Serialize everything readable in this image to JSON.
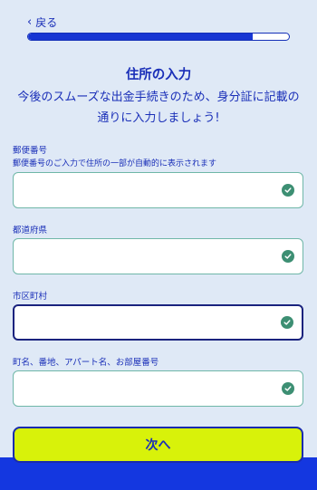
{
  "header": {
    "back_label": "戻る",
    "progress_fraction": 0.86
  },
  "main": {
    "title": "住所の入力",
    "subtitle_line1": "今後のスムーズな出金手続きのため、身分証に記載の",
    "subtitle_line2": "通りに入力しましょう!"
  },
  "fields": {
    "postal": {
      "label": "郵便番号",
      "hint": "郵便番号のご入力で住所の一部が自動的に表示されます",
      "value": ""
    },
    "prefecture": {
      "label": "都道府県",
      "value": ""
    },
    "city": {
      "label": "市区町村",
      "value": ""
    },
    "street": {
      "label": "町名、番地、アパート名、お部屋番号",
      "value": ""
    }
  },
  "footer": {
    "next_label": "次へ"
  },
  "colors": {
    "accent": "#1a2fb8",
    "progress": "#1736d3",
    "button": "#d8f20a",
    "check": "#3d8f73"
  },
  "icons": {
    "back": "chevron-left-icon",
    "valid": "check-circle-icon"
  }
}
